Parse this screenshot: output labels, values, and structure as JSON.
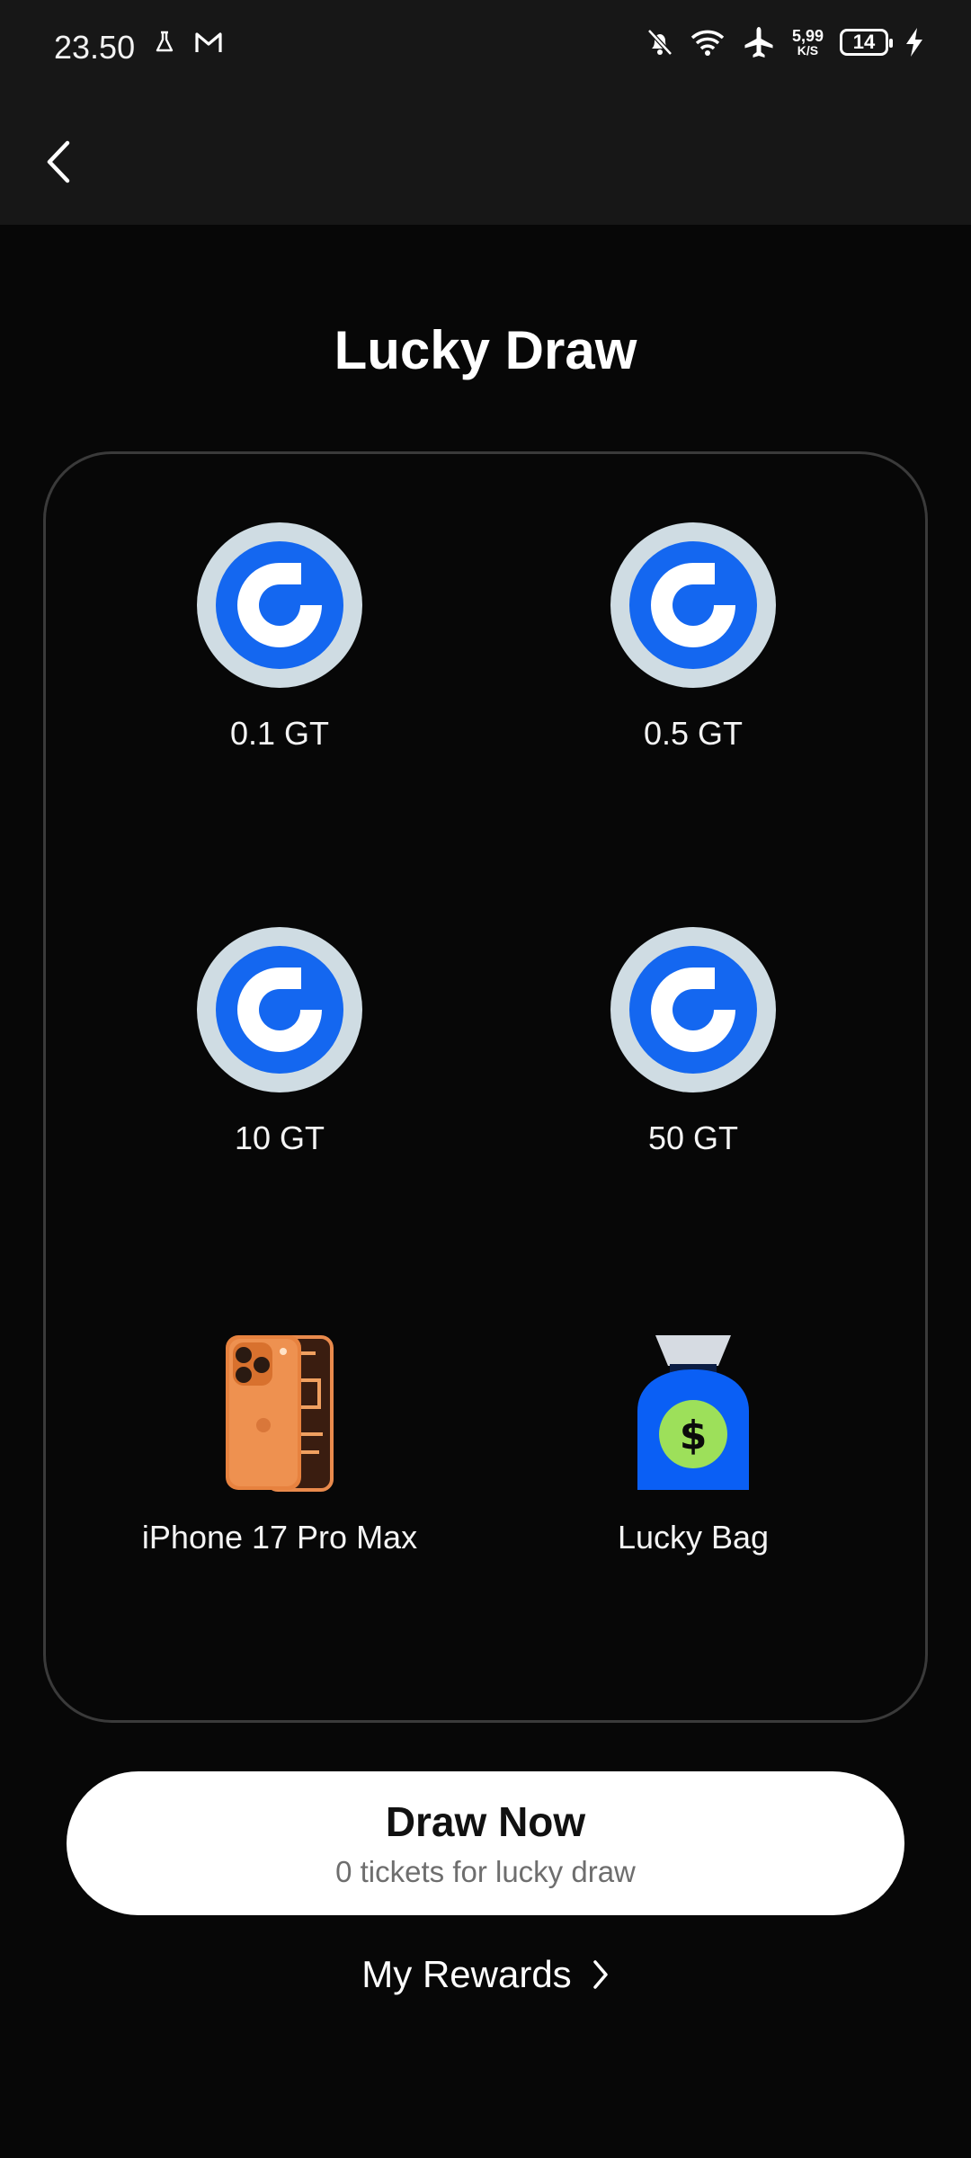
{
  "status_bar": {
    "time": "23.50",
    "net_speed_value": "5,99",
    "net_speed_unit": "K/S",
    "battery_level": "14",
    "icons": [
      "flask-icon",
      "gmail-icon",
      "bell-off-icon",
      "wifi-icon",
      "airplane-icon",
      "battery-icon",
      "charging-icon"
    ]
  },
  "header": {
    "back_icon": "chevron-left-icon"
  },
  "page": {
    "title": "Lucky Draw"
  },
  "prizes": [
    {
      "label": "0.1 GT",
      "icon": "gt-coin-icon"
    },
    {
      "label": "0.5 GT",
      "icon": "gt-coin-icon"
    },
    {
      "label": "10 GT",
      "icon": "gt-coin-icon"
    },
    {
      "label": "50 GT",
      "icon": "gt-coin-icon"
    },
    {
      "label": "iPhone 17 Pro Max",
      "icon": "phone-icon"
    },
    {
      "label": "Lucky Bag",
      "icon": "money-bag-icon"
    }
  ],
  "draw": {
    "button_label": "Draw Now",
    "tickets_text": "0 tickets for lucky draw"
  },
  "rewards": {
    "label": "My Rewards",
    "icon": "chevron-right-icon"
  },
  "colors": {
    "background": "#070707",
    "header_bg": "#171717",
    "coin_blue": "#1467f0",
    "coin_ring": "#cfdce3",
    "bag_blue": "#0a5ff5",
    "bag_coin_green": "#9de05a",
    "phone_orange": "#e7823f"
  }
}
